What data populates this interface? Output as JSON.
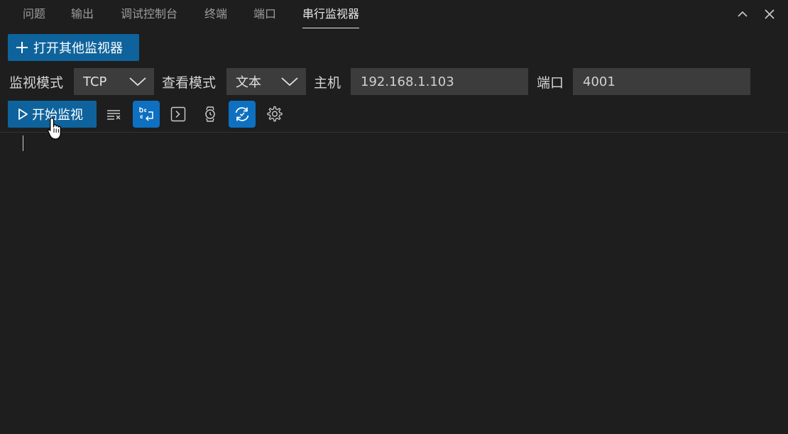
{
  "tabs": [
    {
      "label": "问题"
    },
    {
      "label": "输出"
    },
    {
      "label": "调试控制台"
    },
    {
      "label": "终端"
    },
    {
      "label": "端口"
    },
    {
      "label": "串行监视器",
      "active": true
    }
  ],
  "window_controls": {
    "maximize_icon": "chevron-up-icon",
    "close_icon": "close-icon"
  },
  "open_monitor_button": {
    "label": "打开其他监视器",
    "icon": "plus-icon"
  },
  "config": {
    "monitor_mode_label": "监视模式",
    "monitor_mode_value": "TCP",
    "view_mode_label": "查看模式",
    "view_mode_value": "文本",
    "host_label": "主机",
    "host_value": "192.168.1.103",
    "port_label": "端口",
    "port_value": "4001"
  },
  "toolbar": {
    "start_label": "开始监视",
    "start_icon": "play-icon",
    "tools": [
      {
        "name": "clear-output",
        "icon": "clear-all-icon",
        "active": false
      },
      {
        "name": "word-wrap",
        "icon": "word-wrap-icon",
        "active": true
      },
      {
        "name": "terminal",
        "icon": "terminal-icon",
        "active": false
      },
      {
        "name": "timestamp",
        "icon": "watch-icon",
        "active": false
      },
      {
        "name": "auto-scroll",
        "icon": "sync-icon",
        "active": true
      },
      {
        "name": "settings",
        "icon": "gear-icon",
        "active": false
      }
    ]
  },
  "colors": {
    "background": "#1e1e1e",
    "primary_button": "#0e639c",
    "toggle_active": "#0e70c0",
    "input_background": "#3c3c3c"
  }
}
